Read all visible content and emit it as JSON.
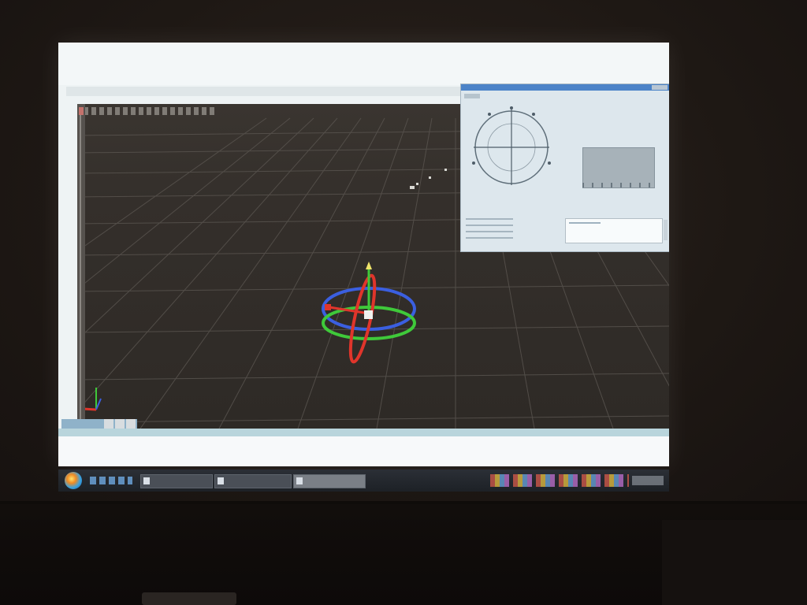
{
  "scene": {
    "description_hidden": "",
    "colors": {
      "wall": "#1c1714",
      "projection": "#eef3f4",
      "viewport": "#342f2b",
      "grid_line": "#5a5550",
      "gizmo_x": "#e0352b",
      "gizmo_y": "#3fc93a",
      "gizmo_z": "#3b5fe0"
    }
  },
  "projected_app": {
    "dialog": {
      "readout": "",
      "dial_icon": "compass-dial-icon"
    },
    "taskbar": {
      "start_icon": "windows-orb-icon",
      "buttons": [
        "",
        "",
        ""
      ]
    }
  }
}
